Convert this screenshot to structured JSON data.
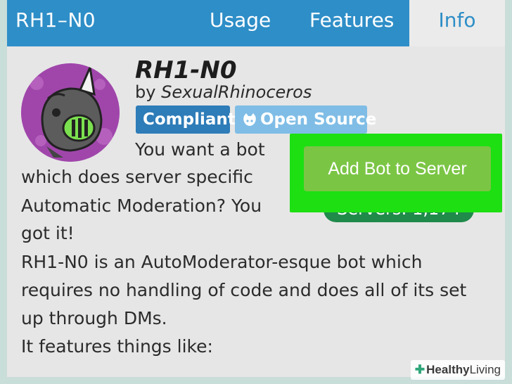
{
  "navbar": {
    "brand": "RH1–N0",
    "tabs": [
      {
        "label": "Usage"
      },
      {
        "label": "Features"
      },
      {
        "label": "Info"
      }
    ]
  },
  "bot": {
    "name": "RH1-N0",
    "by_prefix": "by ",
    "author": "SexualRhinoceros",
    "badges": [
      {
        "label": "Compliant"
      },
      {
        "label": "Open Source"
      }
    ]
  },
  "actions": {
    "add_label": "Add Bot to Server",
    "servers_label": "Servers: 1,174"
  },
  "description": {
    "lines": [
      "You want a bot",
      "which does server specific",
      "Automatic Moderation? You",
      "got it!",
      "RH1-N0 is an AutoModerator-esque bot which",
      "requires no handling of code and does all of its set",
      "up through DMs.",
      "It features things like:"
    ]
  },
  "watermark": {
    "part1": "Healthy",
    "part2": "Living"
  },
  "colors": {
    "navbar": "#2e8ec7",
    "active_tab_bg": "#ebebeb",
    "highlight": "#1ddf12",
    "add_button": "#7bc545",
    "servers_pill": "#1f8a4a",
    "badge_compliant": "#2e7cb8",
    "badge_open_source": "#7fbde6",
    "avatar_bg": "#a046ab"
  },
  "icons": {
    "open_source": "github-icon",
    "watermark": "cross-icon"
  }
}
